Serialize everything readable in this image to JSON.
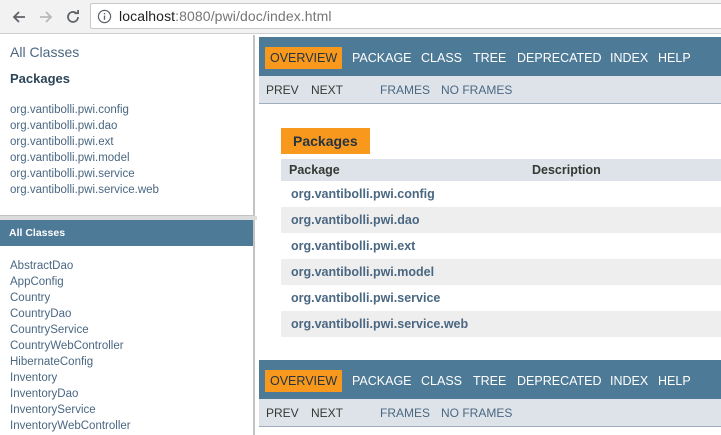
{
  "browser": {
    "url_host": "localhost",
    "url_rest": ":8080/pwi/doc/index.html"
  },
  "packages_frame": {
    "all_classes_link": "All Classes",
    "heading": "Packages",
    "packages": [
      "org.vantibolli.pwi.config",
      "org.vantibolli.pwi.dao",
      "org.vantibolli.pwi.ext",
      "org.vantibolli.pwi.model",
      "org.vantibolli.pwi.service",
      "org.vantibolli.pwi.service.web"
    ]
  },
  "classes_frame": {
    "title": "All Classes",
    "classes": [
      "AbstractDao",
      "AppConfig",
      "Country",
      "CountryDao",
      "CountryService",
      "CountryWebController",
      "HibernateConfig",
      "Inventory",
      "InventoryDao",
      "InventoryService",
      "InventoryWebController"
    ]
  },
  "nav": {
    "items": [
      "OVERVIEW",
      "PACKAGE",
      "CLASS",
      "TREE",
      "DEPRECATED",
      "INDEX",
      "HELP"
    ],
    "active": "OVERVIEW",
    "sub": {
      "prev": "PREV",
      "next": "NEXT",
      "frames": "FRAMES",
      "no_frames": "NO FRAMES"
    }
  },
  "overview": {
    "caption": "Packages",
    "col_package": "Package",
    "col_description": "Description",
    "rows": [
      "org.vantibolli.pwi.config",
      "org.vantibolli.pwi.dao",
      "org.vantibolli.pwi.ext",
      "org.vantibolli.pwi.model",
      "org.vantibolli.pwi.service",
      "org.vantibolli.pwi.service.web"
    ]
  },
  "colors": {
    "nav_bar": "#4d7a97",
    "active_tab": "#f8981d",
    "sub_nav": "#dee3e9",
    "link": "#4a6782"
  },
  "icons": [
    "back-arrow-icon",
    "forward-arrow-icon",
    "reload-icon",
    "info-icon"
  ]
}
